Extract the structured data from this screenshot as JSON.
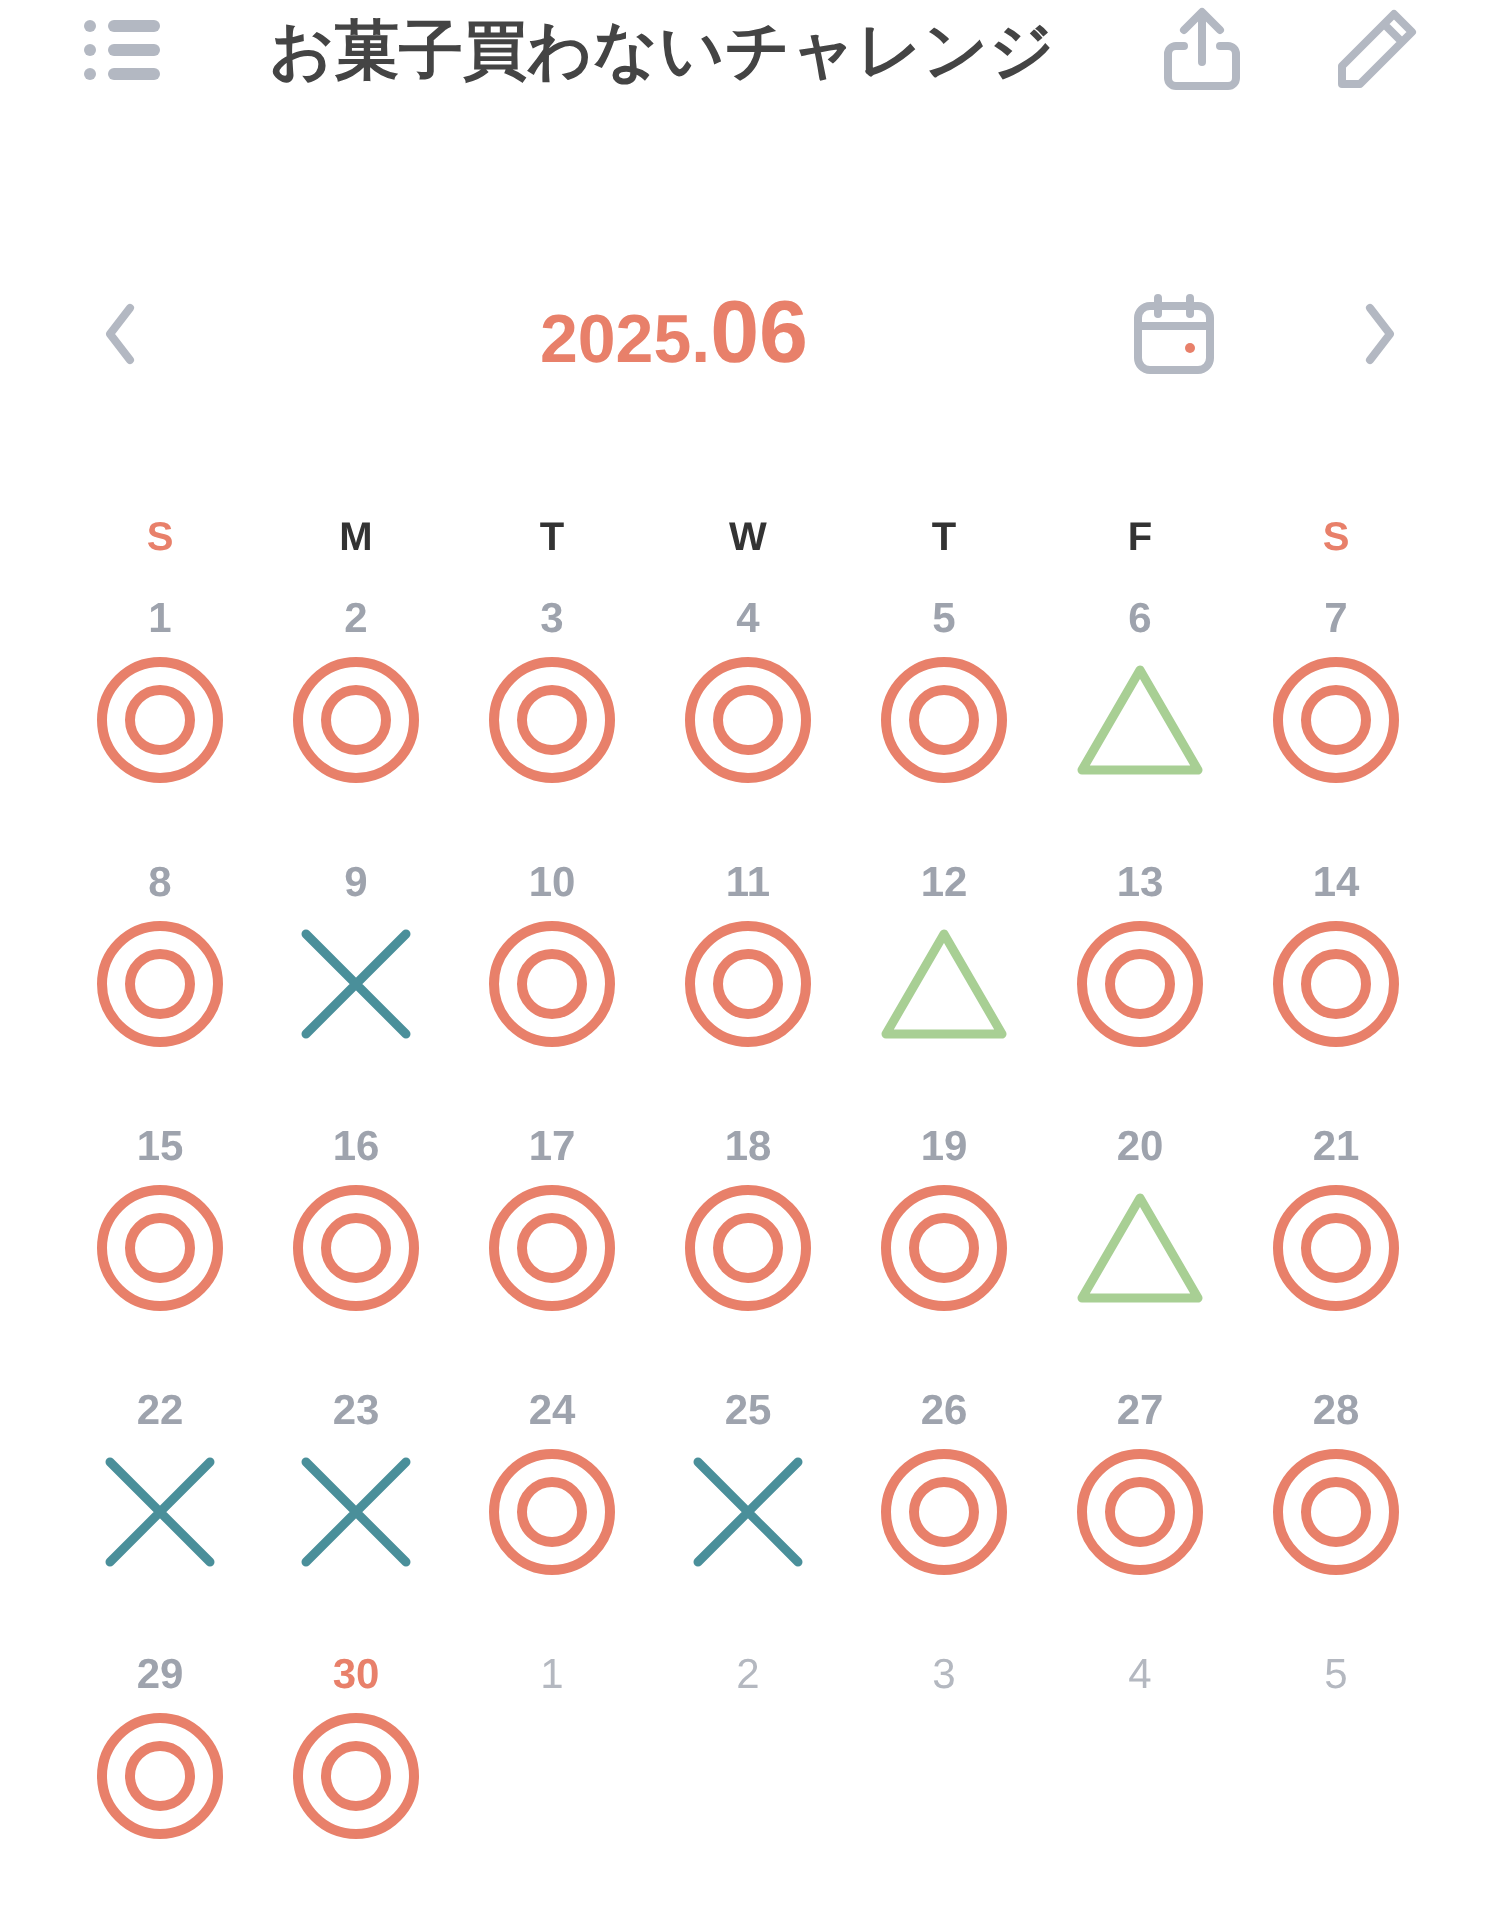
{
  "header": {
    "title": "お菓子買わないチャレンジ"
  },
  "month": {
    "year": "2025.",
    "month": "06"
  },
  "weekdays": [
    {
      "label": "S",
      "weekend": true
    },
    {
      "label": "M",
      "weekend": false
    },
    {
      "label": "T",
      "weekend": false
    },
    {
      "label": "W",
      "weekend": false
    },
    {
      "label": "T",
      "weekend": false
    },
    {
      "label": "F",
      "weekend": false
    },
    {
      "label": "S",
      "weekend": true
    }
  ],
  "days": [
    {
      "day": "1",
      "in_month": true,
      "today": false,
      "kind": "double_circle"
    },
    {
      "day": "2",
      "in_month": true,
      "today": false,
      "kind": "double_circle"
    },
    {
      "day": "3",
      "in_month": true,
      "today": false,
      "kind": "double_circle"
    },
    {
      "day": "4",
      "in_month": true,
      "today": false,
      "kind": "double_circle"
    },
    {
      "day": "5",
      "in_month": true,
      "today": false,
      "kind": "double_circle"
    },
    {
      "day": "6",
      "in_month": true,
      "today": false,
      "kind": "triangle"
    },
    {
      "day": "7",
      "in_month": true,
      "today": false,
      "kind": "double_circle"
    },
    {
      "day": "8",
      "in_month": true,
      "today": false,
      "kind": "double_circle"
    },
    {
      "day": "9",
      "in_month": true,
      "today": false,
      "kind": "cross"
    },
    {
      "day": "10",
      "in_month": true,
      "today": false,
      "kind": "double_circle"
    },
    {
      "day": "11",
      "in_month": true,
      "today": false,
      "kind": "double_circle"
    },
    {
      "day": "12",
      "in_month": true,
      "today": false,
      "kind": "triangle"
    },
    {
      "day": "13",
      "in_month": true,
      "today": false,
      "kind": "double_circle"
    },
    {
      "day": "14",
      "in_month": true,
      "today": false,
      "kind": "double_circle"
    },
    {
      "day": "15",
      "in_month": true,
      "today": false,
      "kind": "double_circle"
    },
    {
      "day": "16",
      "in_month": true,
      "today": false,
      "kind": "double_circle"
    },
    {
      "day": "17",
      "in_month": true,
      "today": false,
      "kind": "double_circle"
    },
    {
      "day": "18",
      "in_month": true,
      "today": false,
      "kind": "double_circle"
    },
    {
      "day": "19",
      "in_month": true,
      "today": false,
      "kind": "double_circle"
    },
    {
      "day": "20",
      "in_month": true,
      "today": false,
      "kind": "triangle"
    },
    {
      "day": "21",
      "in_month": true,
      "today": false,
      "kind": "double_circle"
    },
    {
      "day": "22",
      "in_month": true,
      "today": false,
      "kind": "cross"
    },
    {
      "day": "23",
      "in_month": true,
      "today": false,
      "kind": "cross"
    },
    {
      "day": "24",
      "in_month": true,
      "today": false,
      "kind": "double_circle"
    },
    {
      "day": "25",
      "in_month": true,
      "today": false,
      "kind": "cross"
    },
    {
      "day": "26",
      "in_month": true,
      "today": false,
      "kind": "double_circle"
    },
    {
      "day": "27",
      "in_month": true,
      "today": false,
      "kind": "double_circle"
    },
    {
      "day": "28",
      "in_month": true,
      "today": false,
      "kind": "double_circle"
    },
    {
      "day": "29",
      "in_month": true,
      "today": false,
      "kind": "double_circle"
    },
    {
      "day": "30",
      "in_month": true,
      "today": true,
      "kind": "double_circle"
    },
    {
      "day": "1",
      "in_month": false,
      "today": false,
      "kind": "none"
    },
    {
      "day": "2",
      "in_month": false,
      "today": false,
      "kind": "none"
    },
    {
      "day": "3",
      "in_month": false,
      "today": false,
      "kind": "none"
    },
    {
      "day": "4",
      "in_month": false,
      "today": false,
      "kind": "none"
    },
    {
      "day": "5",
      "in_month": false,
      "today": false,
      "kind": "none"
    }
  ]
}
